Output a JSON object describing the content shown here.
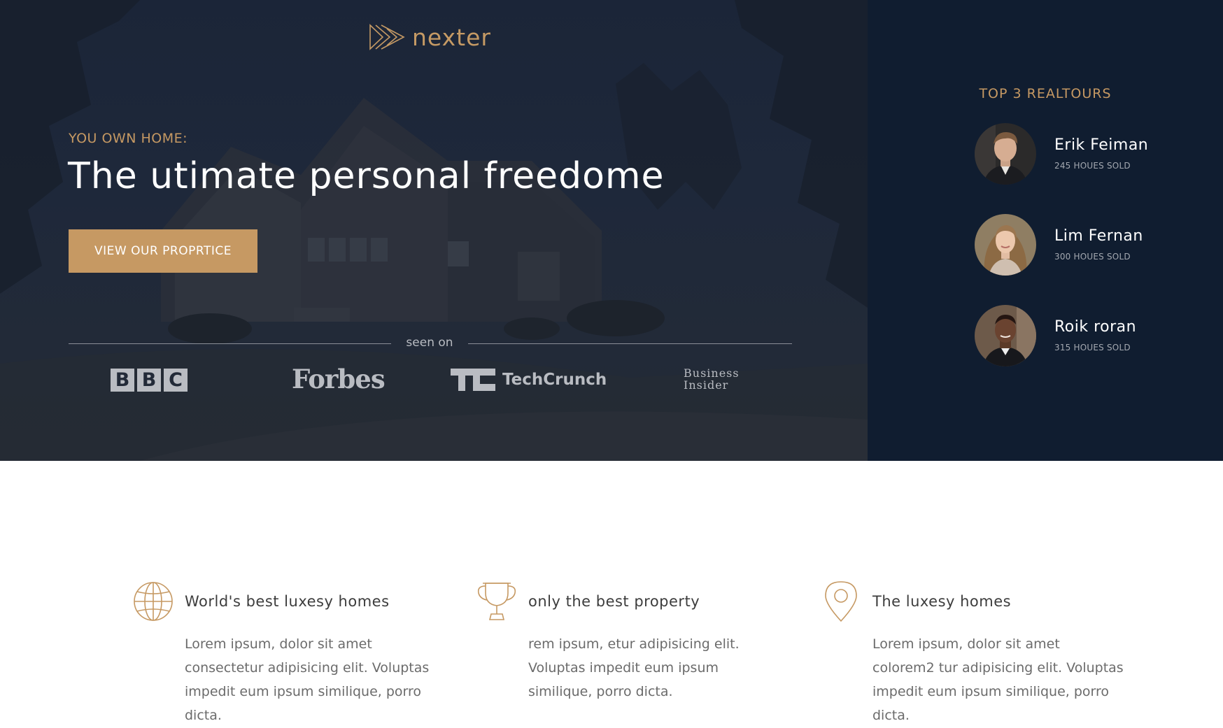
{
  "brand": {
    "name": "nexter",
    "logo_icon": "triple-play-triangles-icon",
    "accent_color": "#c69963"
  },
  "hero": {
    "kicker": "YOU OWN HOME:",
    "headline": "The utimate personal freedome",
    "cta_label": "VIEW OUR PROPRTICE",
    "seen_on": "seen on",
    "press": {
      "bbc": [
        "B",
        "B",
        "C"
      ],
      "forbes": "Forbes",
      "techcrunch": "TechCrunch",
      "business_insider": [
        "Business",
        "Insider"
      ]
    }
  },
  "sidebar": {
    "title": "TOP 3 REALTOURS",
    "realtors": [
      {
        "name": "Erik Feiman",
        "sold": "245 HOUES SOLD"
      },
      {
        "name": "Lim Fernan",
        "sold": "300 HOUES SOLD"
      },
      {
        "name": "Roik roran",
        "sold": "315 HOUES SOLD"
      }
    ],
    "background_color": "#101d30"
  },
  "features": [
    {
      "icon": "globe-icon",
      "title": "World's best luxesy homes",
      "text": "Lorem ipsum, dolor sit amet consectetur adipisicing elit. Voluptas impedit eum ipsum similique, porro dicta."
    },
    {
      "icon": "trophy-icon",
      "title": "only the best property",
      "text": "rem ipsum, etur adipisicing elit. Voluptas impedit eum ipsum similique, porro dicta."
    },
    {
      "icon": "map-pin-icon",
      "title": "The luxesy homes",
      "text": "Lorem ipsum, dolor sit amet colorem2 tur adipisicing elit. Voluptas impedit eum ipsum similique, porro dicta."
    }
  ]
}
